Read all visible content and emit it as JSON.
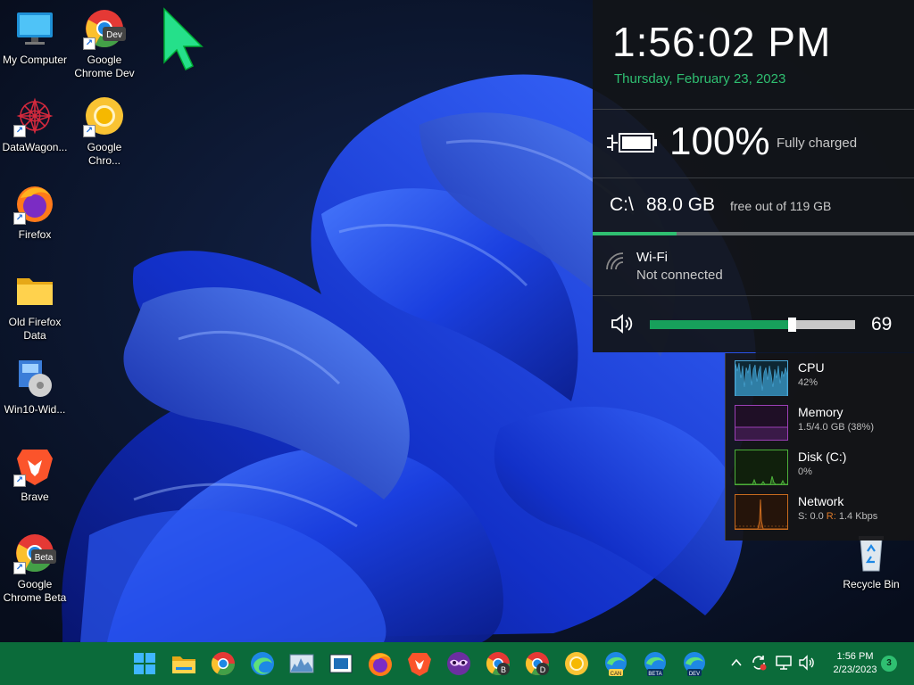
{
  "desktop": {
    "icons": [
      {
        "label": "My Computer",
        "icon": "monitor-icon"
      },
      {
        "label": "Google\nChrome Dev",
        "icon": "chrome-dev-icon",
        "badge": "Dev"
      },
      {
        "label": "DataWagon...",
        "icon": "datawagon-icon"
      },
      {
        "label": "Google\nChro...",
        "icon": "chrome-icon"
      },
      {
        "label": "Firefox",
        "icon": "firefox-icon"
      },
      {
        "label": "Old Firefox\nData",
        "icon": "folder-icon"
      },
      {
        "label": "Win10-Wid...",
        "icon": "installer-icon"
      },
      {
        "label": "Brave",
        "icon": "brave-icon"
      },
      {
        "label": "Google\nChrome Beta",
        "icon": "chrome-beta-icon",
        "badge": "Beta"
      },
      {
        "label": "Recycle Bin",
        "icon": "recycle-bin-icon"
      }
    ]
  },
  "info_panel": {
    "time": "1:56:02 PM",
    "date": "Thursday, February 23, 2023",
    "battery": {
      "percent_text": "100%",
      "status": "Fully charged",
      "level": 1.0
    },
    "drive": {
      "letter": "C:\\",
      "free": "88.0 GB",
      "total": "free out of 119 GB",
      "used_fraction": 0.26
    },
    "wifi": {
      "name": "Wi-Fi",
      "status": "Not connected"
    },
    "volume": {
      "value": "69",
      "level": 0.69
    }
  },
  "perf": [
    {
      "title": "CPU",
      "value": "42%",
      "color": "#4aa8d8",
      "bg": "#0e2733"
    },
    {
      "title": "Memory",
      "value": "1.5/4.0 GB (38%)",
      "color": "#9b3fb5",
      "bg": "#1f0f26"
    },
    {
      "title": "Disk (C:)",
      "value": "0%",
      "color": "#4caf3a",
      "bg": "#10200c"
    },
    {
      "title": "Network",
      "value_s": "S: 0.0 ",
      "value_r_label": "R:",
      "value_r": " 1.4 Kbps",
      "color": "#c86a1e",
      "bg": "#25140a"
    }
  ],
  "taskbar": {
    "items": [
      "start-icon",
      "file-explorer-icon",
      "chrome-icon",
      "edge-icon",
      "resource-monitor-icon",
      "app-window-icon",
      "firefox-icon",
      "brave-icon",
      "mask-icon",
      "chrome-b-icon",
      "chrome-d-icon",
      "chrome-canary-icon",
      "edge-can-icon",
      "edge-beta-icon",
      "edge-dev-icon"
    ],
    "tray": {
      "time": "1:56 PM",
      "date": "2/23/2023",
      "notifications": "3"
    }
  },
  "colors": {
    "accent": "#2fbf71",
    "taskbar": "#0b6b3a",
    "panel": "#121418"
  }
}
